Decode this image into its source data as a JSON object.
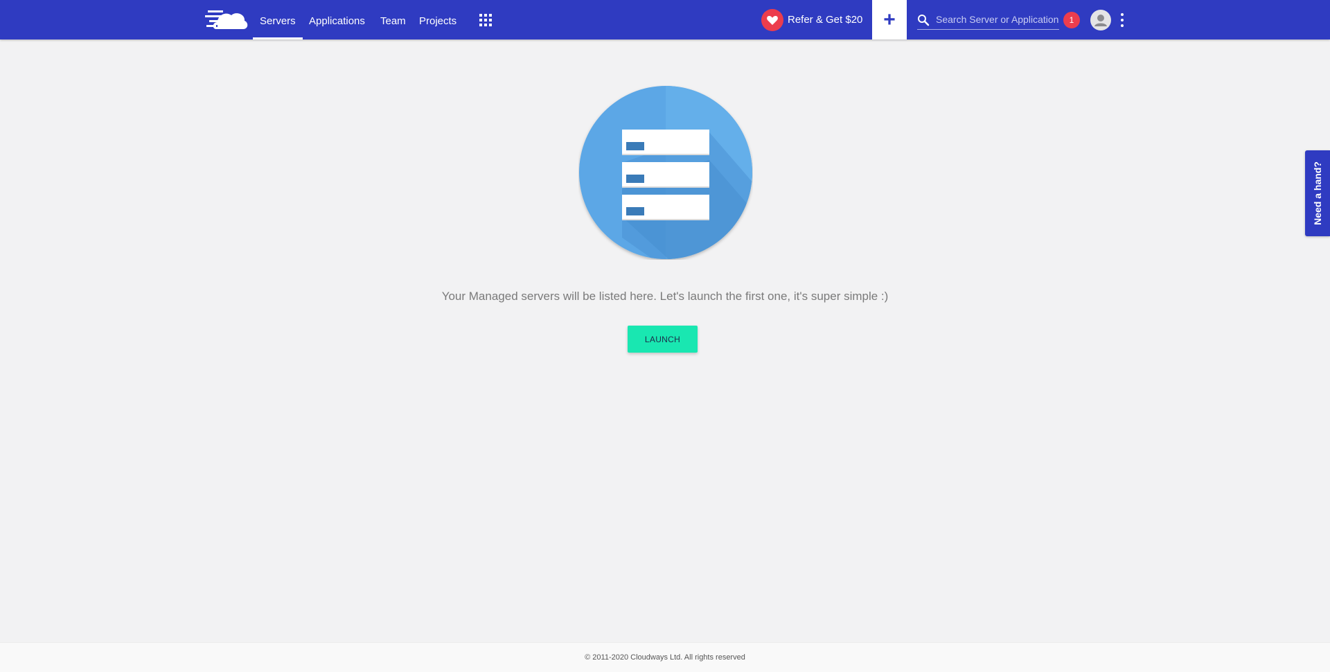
{
  "nav": {
    "items": [
      {
        "label": "Servers",
        "active": true
      },
      {
        "label": "Applications",
        "active": false
      },
      {
        "label": "Team",
        "active": false
      },
      {
        "label": "Projects",
        "active": false
      }
    ],
    "apps_icon": "grid-icon",
    "logo_icon": "cloud-logo-icon"
  },
  "header": {
    "refer_label": "Refer & Get $20",
    "refer_icon": "heart-icon",
    "add_icon": "plus-icon",
    "search_placeholder": "Search Server or Application",
    "search_value": "",
    "search_icon": "search-icon",
    "notification_count": "1",
    "avatar_icon": "user-avatar-icon",
    "menu_icon": "more-vert-icon"
  },
  "main": {
    "illustration_icon": "server-stack-icon",
    "empty_message": "Your Managed servers will be listed here. Let's launch the first one, it's super simple :)",
    "launch_label": "LAUNCH"
  },
  "help_tab": {
    "label": "Need a hand?"
  },
  "footer": {
    "copyright": "© 2011-2020 Cloudways Ltd. All rights reserved"
  },
  "colors": {
    "topbar": "#2f3bc1",
    "accent_green": "#19e7b1",
    "badge_red": "#ec3d4d",
    "illustration_blue": "#5ba7e6",
    "background": "#f2f2f3"
  }
}
